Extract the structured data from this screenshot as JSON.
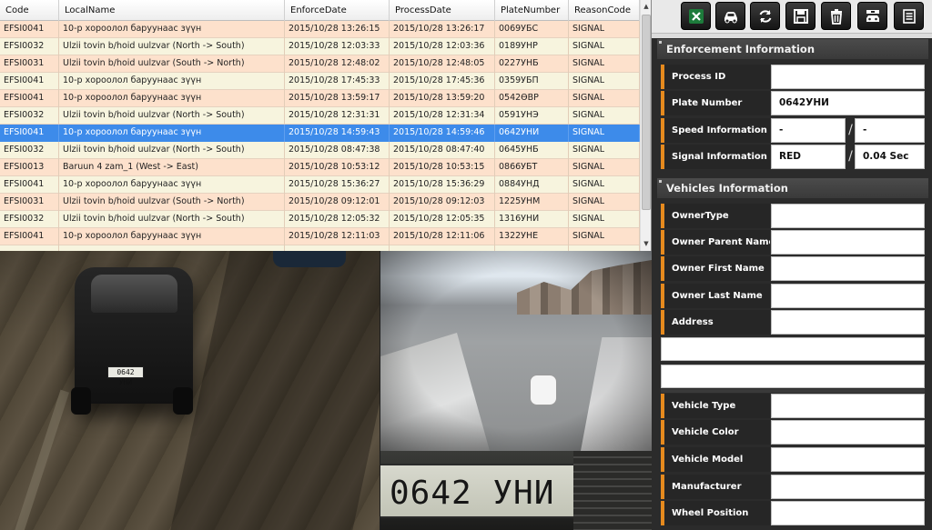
{
  "grid": {
    "columns": [
      "Code",
      "LocalName",
      "EnforceDate",
      "ProcessDate",
      "PlateNumber",
      "ReasonCode"
    ],
    "rows": [
      [
        "EFSI0041",
        "10-р хороолол баруунаас зүүн",
        "2015/10/28 13:26:15",
        "2015/10/28 13:26:17",
        "0069УБС",
        "SIGNAL"
      ],
      [
        "EFSI0032",
        "Ulzii tovin b/hoid uulzvar (North -> South)",
        "2015/10/28 12:03:33",
        "2015/10/28 12:03:36",
        "0189УНР",
        "SIGNAL"
      ],
      [
        "EFSI0031",
        "Ulzii tovin b/hoid uulzvar (South -> North)",
        "2015/10/28 12:48:02",
        "2015/10/28 12:48:05",
        "0227УНБ",
        "SIGNAL"
      ],
      [
        "EFSI0041",
        "10-р хороолол баруунаас зүүн",
        "2015/10/28 17:45:33",
        "2015/10/28 17:45:36",
        "0359УБП",
        "SIGNAL"
      ],
      [
        "EFSI0041",
        "10-р хороолол баруунаас зүүн",
        "2015/10/28 13:59:17",
        "2015/10/28 13:59:20",
        "0542ӨВР",
        "SIGNAL"
      ],
      [
        "EFSI0032",
        "Ulzii tovin b/hoid uulzvar (North -> South)",
        "2015/10/28 12:31:31",
        "2015/10/28 12:31:34",
        "0591УНЭ",
        "SIGNAL"
      ],
      [
        "EFSI0041",
        "10-р хороолол баруунаас зүүн",
        "2015/10/28 14:59:43",
        "2015/10/28 14:59:46",
        "0642УНИ",
        "SIGNAL"
      ],
      [
        "EFSI0032",
        "Ulzii tovin b/hoid uulzvar (North -> South)",
        "2015/10/28 08:47:38",
        "2015/10/28 08:47:40",
        "0645УНБ",
        "SIGNAL"
      ],
      [
        "EFSI0013",
        "Baruun 4 zam_1 (West -> East)",
        "2015/10/28 10:53:12",
        "2015/10/28 10:53:15",
        "0866УБТ",
        "SIGNAL"
      ],
      [
        "EFSI0041",
        "10-р хороолол баруунаас зүүн",
        "2015/10/28 15:36:27",
        "2015/10/28 15:36:29",
        "0884УНД",
        "SIGNAL"
      ],
      [
        "EFSI0031",
        "Ulzii tovin b/hoid uulzvar (South -> North)",
        "2015/10/28 09:12:01",
        "2015/10/28 09:12:03",
        "1225УНМ",
        "SIGNAL"
      ],
      [
        "EFSI0032",
        "Ulzii tovin b/hoid uulzvar (North -> South)",
        "2015/10/28 12:05:32",
        "2015/10/28 12:05:35",
        "1316УНИ",
        "SIGNAL"
      ],
      [
        "EFSI0041",
        "10-р хороолол баруунаас зүүн",
        "2015/10/28 12:11:03",
        "2015/10/28 12:11:06",
        "1322УНЕ",
        "SIGNAL"
      ],
      [
        "",
        "",
        "",
        "",
        "",
        ""
      ]
    ],
    "selected_index": 6
  },
  "camera": {
    "car_plate_text": "0642 УНИ",
    "plate_crop_text": "0642 УНИ"
  },
  "toolbar": {
    "buttons": [
      "excel-icon",
      "car-icon",
      "refresh-icon",
      "save-icon",
      "trash-icon",
      "car-settings-icon",
      "list-icon"
    ]
  },
  "enforcement": {
    "title": "Enforcement Information",
    "process_id_label": "Process ID",
    "process_id_value": "",
    "plate_number_label": "Plate Number",
    "plate_number_value": "0642УНИ",
    "speed_label": "Speed Information",
    "speed_value_1": "-",
    "speed_value_2": "-",
    "signal_label": "Signal Information",
    "signal_value_1": "RED",
    "signal_value_2": "0.04 Sec",
    "separator": "/"
  },
  "vehicles": {
    "title": "Vehicles Information",
    "owner_type_label": "OwnerType",
    "owner_parent_label": "Owner Parent Name",
    "owner_first_label": "Owner First Name",
    "owner_last_label": "Owner Last Name",
    "address_label": "Address",
    "vehicle_type_label": "Vehicle Type",
    "vehicle_color_label": "Vehicle Color",
    "vehicle_model_label": "Vehicle Model",
    "manufacturer_label": "Manufacturer",
    "wheel_position_label": "Wheel Position"
  },
  "colors": {
    "accent_orange": "#e68a1e",
    "row_selected": "#3d8bea",
    "row_even": "#fde1cc",
    "row_odd": "#f7f4de",
    "excel_green": "#1d7b3b"
  }
}
